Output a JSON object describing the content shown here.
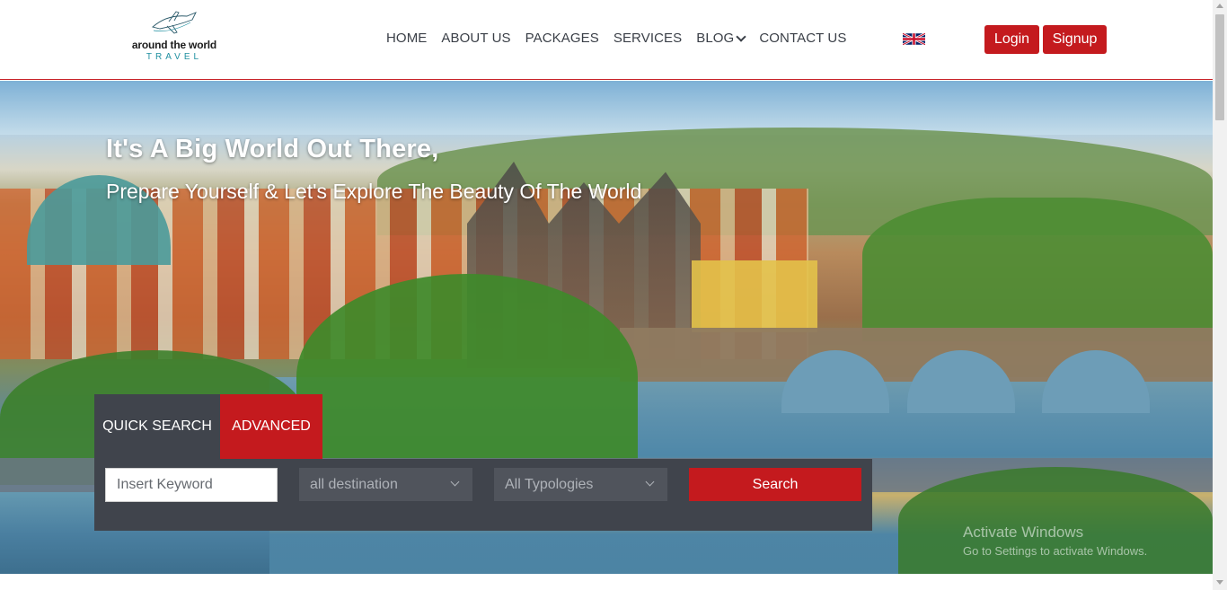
{
  "logo": {
    "brand": "around the world",
    "sub": "TRAVEL",
    "icon": "airplane-icon"
  },
  "nav": {
    "items": [
      "HOME",
      "ABOUT US",
      "PACKAGES",
      "SERVICES",
      "BLOG",
      "CONTACT US"
    ]
  },
  "header": {
    "language_flag": "uk-flag-icon",
    "login_label": "Login",
    "signup_label": "Signup",
    "accent_color": "#c41a1e"
  },
  "hero": {
    "title": "It's A Big World Out There,",
    "subtitle": "Prepare Yourself & Let's Explore The Beauty Of The World"
  },
  "search": {
    "tab_quick": "QUICK SEARCH",
    "tab_advanced": "ADVANCED",
    "keyword_placeholder": "Insert Keyword",
    "destination_value": "all destination",
    "typology_value": "All Typologies",
    "search_label": "Search"
  },
  "watermark": {
    "line1": "Activate Windows",
    "line2": "Go to Settings to activate Windows."
  }
}
